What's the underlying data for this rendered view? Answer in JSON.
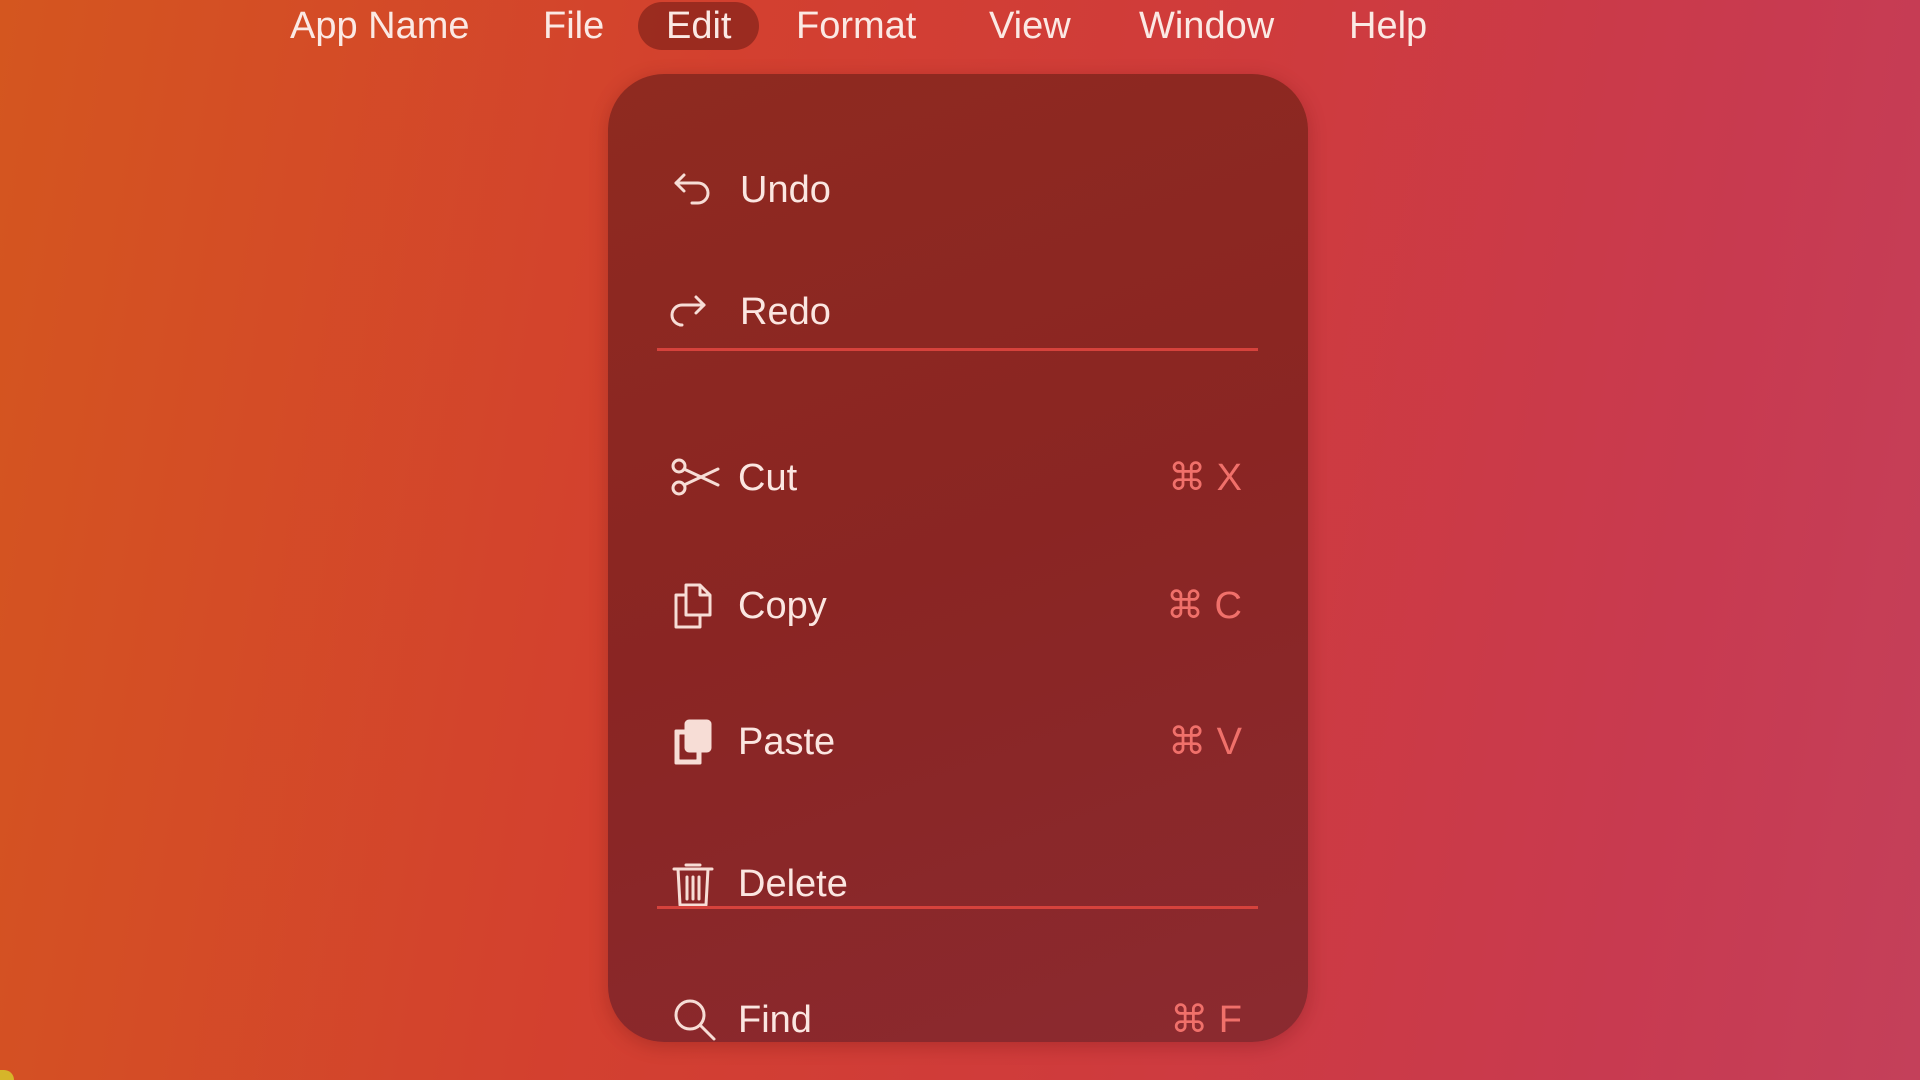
{
  "menubar": {
    "items": [
      {
        "label": "App Name"
      },
      {
        "label": "File"
      },
      {
        "label": "Edit",
        "active": true
      },
      {
        "label": "Format"
      },
      {
        "label": "View"
      },
      {
        "label": "Window"
      },
      {
        "label": "Help"
      }
    ]
  },
  "edit_menu": {
    "items": [
      {
        "label": "Undo",
        "icon": "undo-icon",
        "shortcut": ""
      },
      {
        "label": "Redo",
        "icon": "redo-icon",
        "shortcut": ""
      },
      {
        "label": "Cut",
        "icon": "scissors-icon",
        "shortcut": "⌘ X"
      },
      {
        "label": "Copy",
        "icon": "copy-icon",
        "shortcut": "⌘ C"
      },
      {
        "label": "Paste",
        "icon": "paste-icon",
        "shortcut": "⌘ V"
      },
      {
        "label": "Delete",
        "icon": "trash-icon",
        "shortcut": ""
      },
      {
        "label": "Find",
        "icon": "search-icon",
        "shortcut": "⌘ F"
      }
    ]
  },
  "colors": {
    "background_start": "#d4561f",
    "background_end": "#c4405a",
    "menu_background": "#8a2523",
    "separator": "#d6423c",
    "shortcut_text": "#f0706a",
    "menu_text": "#fbe6e1"
  }
}
